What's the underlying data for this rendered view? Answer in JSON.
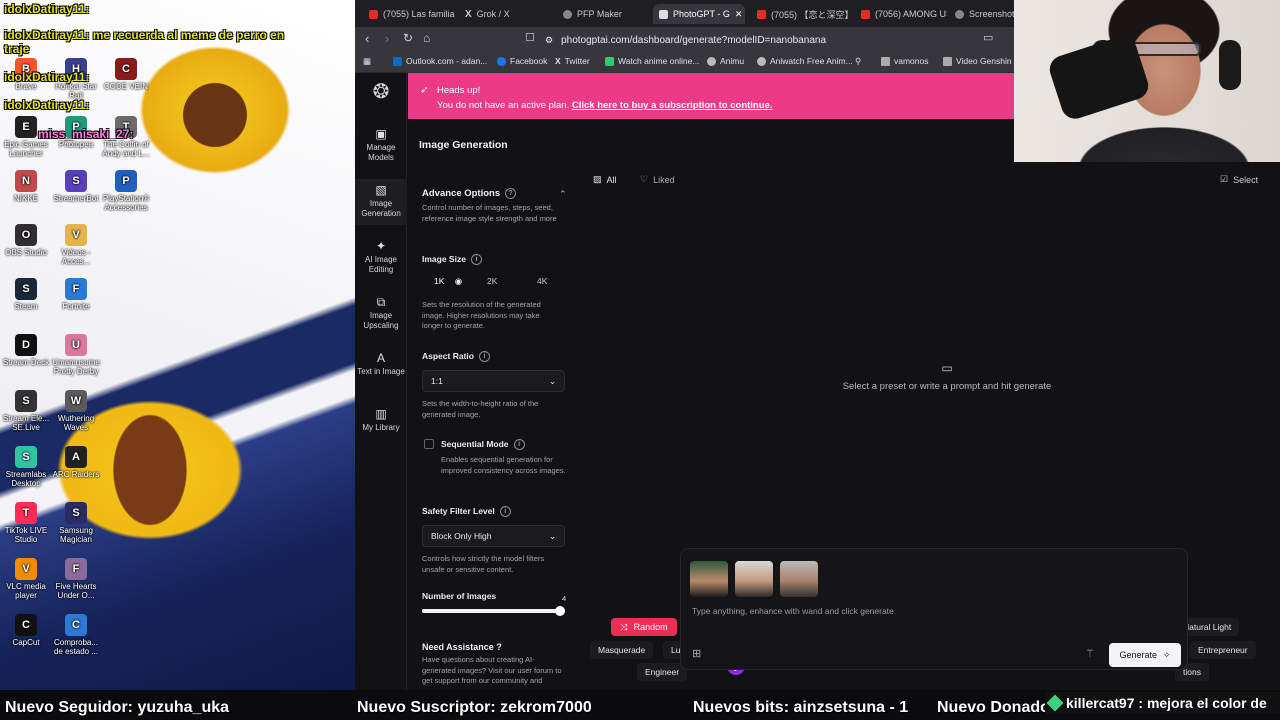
{
  "stream_overlay": {
    "chat_lines": [
      {
        "text": "idolxDatiray11:",
        "color": "yellow"
      },
      {
        "text": "idolxDatiray11: me recuerda al meme de perro en traje",
        "color": "yellow"
      },
      {
        "text": "idolxDatiray11:",
        "color": "yellow"
      },
      {
        "text": "idolxDatiray11:",
        "color": "yellow"
      },
      {
        "text": "miss_misaki_27:",
        "color": "pink"
      }
    ],
    "ticker": {
      "follower": "Nuevo Seguidor: yuzuha_uka",
      "subscriber": "Nuevo Suscriptor: zekrom7000",
      "bits": "Nuevos bits: ainzsetsuna - 1",
      "donor": "Nuevo Donador: Anonymous - $16"
    },
    "chat_popup": "killercat97 : mejora el color de"
  },
  "desktop_icons": [
    {
      "label": "Brave",
      "color": "#fb542b",
      "glyph": "B"
    },
    {
      "label": "Honkai Star Rail",
      "color": "#3b3f8f",
      "glyph": "H"
    },
    {
      "label": "CODE VEIN",
      "color": "#8b1a1a",
      "glyph": "C"
    },
    {
      "label": "Epic Games Launcher",
      "color": "#222",
      "glyph": "E"
    },
    {
      "label": "Photopea",
      "color": "#1e9a7a",
      "glyph": "P"
    },
    {
      "label": "The Coffin of Andy and L...",
      "color": "#6b6b6b",
      "glyph": "T"
    },
    {
      "label": "NIKKE",
      "color": "#c04a4a",
      "glyph": "N"
    },
    {
      "label": "StreamerBot",
      "color": "#5a3fbd",
      "glyph": "S"
    },
    {
      "label": "PlayStation® Accessories",
      "color": "#1f5fc2",
      "glyph": "P"
    },
    {
      "label": "OBS Studio",
      "color": "#302e31",
      "glyph": "O"
    },
    {
      "label": "Videos - Acces...",
      "color": "#e6b34a",
      "glyph": "V"
    },
    {
      "label": "Steam",
      "color": "#1b2838",
      "glyph": "S"
    },
    {
      "label": "Fortnite",
      "color": "#2a7ad6",
      "glyph": "F"
    },
    {
      "label": "Stream Deck",
      "color": "#111",
      "glyph": "D"
    },
    {
      "label": "Umamusume Pretty Derby",
      "color": "#d9779c",
      "glyph": "U"
    },
    {
      "label": "Stream Ele... SE.Live",
      "color": "#333",
      "glyph": "S"
    },
    {
      "label": "Wuthering Waves",
      "color": "#5a5a5a",
      "glyph": "W"
    },
    {
      "label": "Streamlabs Desktop",
      "color": "#31c3a2",
      "glyph": "S"
    },
    {
      "label": "ARC Raiders",
      "color": "#222",
      "glyph": "A"
    },
    {
      "label": "TikTok LIVE Studio",
      "color": "#fe2c55",
      "glyph": "T"
    },
    {
      "label": "Samsung Magician",
      "color": "#2b2b66",
      "glyph": "S"
    },
    {
      "label": "VLC media player",
      "color": "#f08c00",
      "glyph": "V"
    },
    {
      "label": "Five Hearts Under O...",
      "color": "#8a6a9a",
      "glyph": "F"
    },
    {
      "label": "CapCut",
      "color": "#111",
      "glyph": "C"
    },
    {
      "label": "Comproba... de estado ...",
      "color": "#2a7ad6",
      "glyph": "C"
    }
  ],
  "browser": {
    "tabs": [
      {
        "label": "(7055) Las familia",
        "icon": "youtube-icon",
        "color": "#e52d27",
        "active": false
      },
      {
        "label": "Grok / X",
        "icon": "x-icon",
        "color": "#ffffff",
        "active": false
      },
      {
        "label": "PFP Maker",
        "icon": "pfp-icon",
        "color": "#aaaaaa",
        "active": false
      },
      {
        "label": "PhotoGPT - G",
        "icon": "photogpt-icon",
        "color": "#dddddd",
        "active": true
      },
      {
        "label": "(7055) 【恋と深空】",
        "icon": "youtube-icon",
        "color": "#e52d27",
        "active": false
      },
      {
        "label": "(7056) AMONG US",
        "icon": "youtube-icon",
        "color": "#e52d27",
        "active": false
      },
      {
        "label": "Screenshot_2",
        "icon": "globe-icon",
        "color": "#aaaaaa",
        "active": false
      }
    ],
    "url": "photogptai.com/dashboard/generate?modelID=nanobanana",
    "bookmarks": [
      {
        "label": "Outlook.com - adan...",
        "color": "#0f6cbd"
      },
      {
        "label": "Facebook",
        "color": "#1877f2"
      },
      {
        "label": "Twitter",
        "color": "#ffffff"
      },
      {
        "label": "Watch anime online...",
        "color": "#2ecc71"
      },
      {
        "label": "Animu",
        "color": "#cccccc"
      },
      {
        "label": "Aniwatch Free Anim...",
        "color": "#cccccc"
      },
      {
        "label": "vamonos",
        "color": "#cccccc"
      },
      {
        "label": "Video Genshin F",
        "color": "#cccccc"
      }
    ]
  },
  "app": {
    "rail": [
      {
        "label": "Manage Models",
        "icon": "chip-icon",
        "glyph": "▣"
      },
      {
        "label": "Image Generation",
        "icon": "image-icon",
        "glyph": "▧",
        "active": true
      },
      {
        "label": "AI Image Editing",
        "icon": "sparkle-icon",
        "glyph": "✦"
      },
      {
        "label": "Image Upscaling",
        "icon": "upscale-icon",
        "glyph": "⧉"
      },
      {
        "label": "Text in Image",
        "icon": "text-icon",
        "glyph": "A̲"
      },
      {
        "label": "My Library",
        "icon": "library-icon",
        "glyph": "▥"
      }
    ],
    "banner": {
      "title": "Heads up!",
      "text": "You do not have an active plan.",
      "link": "Click here to buy a subscription to continue."
    },
    "page_title": "Image Generation",
    "panel": {
      "advance_title": "Advance Options",
      "advance_desc": "Control number of images, steps, seed, reference image style strength and more",
      "size_label": "Image Size",
      "sizes": [
        "1K",
        "2K",
        "4K"
      ],
      "size_selected": "1K",
      "size_desc": "Sets the resolution of the generated image. Higher resolutions may take longer to generate.",
      "aspect_label": "Aspect Ratio",
      "aspect_value": "1:1",
      "aspect_desc": "Sets the width-to-height ratio of the generated image.",
      "sequential_label": "Sequential Mode",
      "sequential_checked": false,
      "sequential_desc": "Enables sequential generation for improved consistency across images.",
      "safety_label": "Safety Filter Level",
      "safety_value": "Block Only High",
      "safety_desc": "Controls how strictly the model filters unsafe or sensitive content.",
      "num_images_label": "Number of Images",
      "num_images_value": "4",
      "num_images_fraction": 1.0,
      "assist_title": "Need Assistance ?",
      "assist_desc": "Have questions about creating AI-generated images? Visit our user forum to get support from our community and"
    },
    "gallery": {
      "filter_all": "All",
      "filter_liked": "Liked",
      "select": "Select",
      "empty": "Select a preset or write a prompt and hit generate"
    },
    "prompt": {
      "placeholder": "Type anything, enhance with wand and click generate",
      "generate": "Generate",
      "random": "Random",
      "presets": [
        "Masquerade",
        "Lu",
        "Natural Light",
        "Entrepreneur",
        "Engineer",
        "tions"
      ]
    },
    "avatar_letter": "j"
  }
}
